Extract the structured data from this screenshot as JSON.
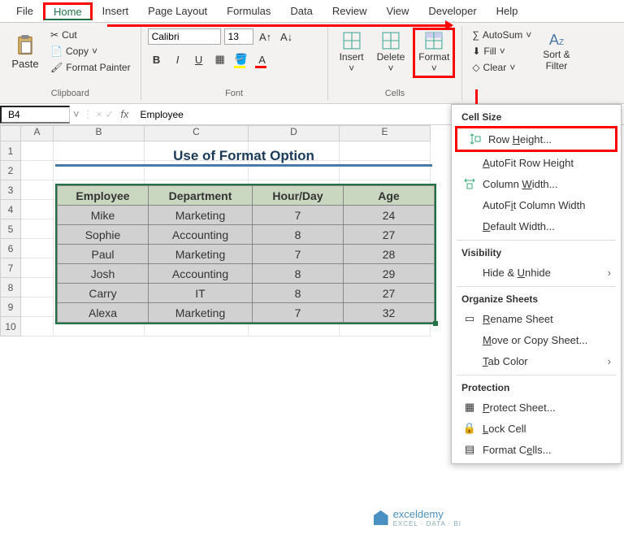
{
  "menu": {
    "tabs": [
      "File",
      "Home",
      "Insert",
      "Page Layout",
      "Formulas",
      "Data",
      "Review",
      "View",
      "Developer",
      "Help"
    ],
    "active": "Home"
  },
  "ribbon": {
    "clipboard": {
      "paste": "Paste",
      "cut": "Cut",
      "copy": "Copy",
      "painter": "Format Painter",
      "label": "Clipboard"
    },
    "font": {
      "name": "Calibri",
      "size": "13",
      "label": "Font"
    },
    "cells": {
      "insert": "Insert",
      "delete": "Delete",
      "format": "Format",
      "label": "Cells"
    },
    "editing": {
      "autosum": "AutoSum",
      "fill": "Fill",
      "clear": "Clear",
      "sortfilter": "Sort &\nFilter"
    }
  },
  "namebox": "B4",
  "formula": "Employee",
  "columns": [
    "A",
    "B",
    "C",
    "D",
    "E"
  ],
  "row_numbers": [
    "1",
    "2",
    "3",
    "4",
    "5",
    "6",
    "7",
    "8",
    "9",
    "10"
  ],
  "title": "Use of Format Option",
  "table": {
    "headers": [
      "Employee",
      "Department",
      "Hour/Day",
      "Age"
    ],
    "rows": [
      [
        "Mike",
        "Marketing",
        "7",
        "24"
      ],
      [
        "Sophie",
        "Accounting",
        "8",
        "27"
      ],
      [
        "Paul",
        "Marketing",
        "7",
        "28"
      ],
      [
        "Josh",
        "Accounting",
        "8",
        "29"
      ],
      [
        "Carry",
        "IT",
        "8",
        "27"
      ],
      [
        "Alexa",
        "Marketing",
        "7",
        "32"
      ]
    ]
  },
  "dropdown": {
    "sections": {
      "cell_size": {
        "header": "Cell Size",
        "row_height": "Row Height...",
        "autofit_row": "AutoFit Row Height",
        "col_width": "Column Width...",
        "autofit_col": "AutoFit Column Width",
        "default_width": "Default Width..."
      },
      "visibility": {
        "header": "Visibility",
        "hide_unhide": "Hide & Unhide"
      },
      "organize": {
        "header": "Organize Sheets",
        "rename": "Rename Sheet",
        "move_copy": "Move or Copy Sheet...",
        "tab_color": "Tab Color"
      },
      "protection": {
        "header": "Protection",
        "protect": "Protect Sheet...",
        "lock": "Lock Cell",
        "format_cells": "Format Cells..."
      }
    }
  },
  "watermark": {
    "name": "exceldemy",
    "sub": "EXCEL · DATA · BI"
  },
  "chart_data": {
    "type": "table",
    "title": "Use of Format Option",
    "columns": [
      "Employee",
      "Department",
      "Hour/Day",
      "Age"
    ],
    "rows": [
      {
        "Employee": "Mike",
        "Department": "Marketing",
        "Hour/Day": 7,
        "Age": 24
      },
      {
        "Employee": "Sophie",
        "Department": "Accounting",
        "Hour/Day": 8,
        "Age": 27
      },
      {
        "Employee": "Paul",
        "Department": "Marketing",
        "Hour/Day": 7,
        "Age": 28
      },
      {
        "Employee": "Josh",
        "Department": "Accounting",
        "Hour/Day": 8,
        "Age": 29
      },
      {
        "Employee": "Carry",
        "Department": "IT",
        "Hour/Day": 8,
        "Age": 27
      },
      {
        "Employee": "Alexa",
        "Department": "Marketing",
        "Hour/Day": 7,
        "Age": 32
      }
    ]
  }
}
